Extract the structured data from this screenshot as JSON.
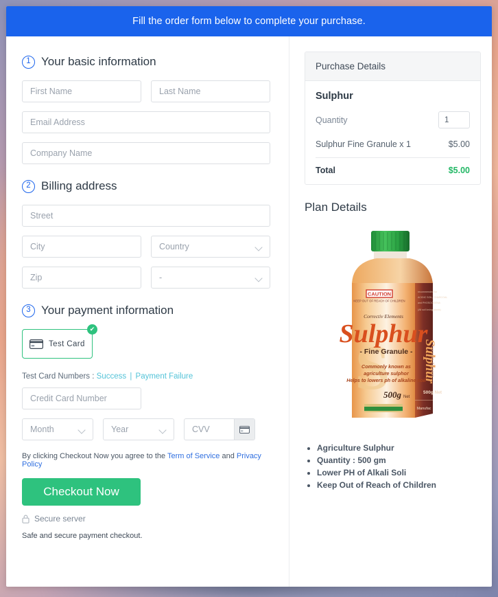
{
  "banner": {
    "text": "Fill the order form below to complete your purchase."
  },
  "sections": {
    "basic": {
      "number": "1",
      "title": "Your basic information",
      "fields": {
        "first_name": "First Name",
        "last_name": "Last Name",
        "email": "Email Address",
        "company": "Company Name"
      }
    },
    "billing": {
      "number": "2",
      "title": "Billing address",
      "fields": {
        "street": "Street",
        "city": "City",
        "country": "Country",
        "zip": "Zip",
        "state": "-"
      }
    },
    "payment": {
      "number": "3",
      "title": "Your payment information",
      "method": {
        "label": "Test Card",
        "icon": "credit-card-icon",
        "selected_icon": "check-circle-icon",
        "selected_check": "✔"
      },
      "test_cards": {
        "prefix": "Test Card Numbers :",
        "success": "Success",
        "separator": "|",
        "failure": "Payment Failure"
      },
      "fields": {
        "card_number": "Credit Card Number",
        "month": "Month",
        "year": "Year",
        "cvv": "CVV"
      }
    }
  },
  "terms": {
    "prefix": "By clicking Checkout Now you agree to the",
    "link1": "Term of Service",
    "middle": "and",
    "link2": "Privacy Policy"
  },
  "checkout": {
    "button_label": "Checkout Now",
    "secure_label": "Secure server",
    "lock_icon": "lock-icon",
    "safe_note": "Safe and secure payment checkout."
  },
  "purchase": {
    "header": "Purchase Details",
    "product_name": "Sulphur",
    "quantity_label": "Quantity",
    "quantity_value": "1",
    "line_item_label": "Sulphur Fine Granule x 1",
    "line_item_price": "$5.00",
    "total_label": "Total",
    "total_price": "$5.00"
  },
  "plan": {
    "title": "Plan Details",
    "image": {
      "alt": "sulphur-fine-granule-package",
      "cap_color": "#27a844",
      "body_color": "#f0a35a",
      "side_color": "#8c3a2f",
      "caution_label": "CAUTION",
      "caution_sub": "KEEP OUT OF REACH OF CHILDREN",
      "brand_line": "Correctiv Elements",
      "product_title": "Sulphur",
      "product_sub": "- Fine Granule -",
      "desc_line1": "Commonly known as",
      "desc_line2": "agriculture sulphor",
      "desc_line3": "Helps to lowers ph of alkaline soil",
      "weight": "500g",
      "weight_unit": "Net",
      "watermark": "S",
      "side_text": "Sulphur",
      "side_sub": "Correctiv Elements",
      "side_weight": "500g Net",
      "side_footer": "Manufac"
    },
    "features": [
      "Agriculture Sulphur",
      "Quantity : 500 gm",
      "Lower PH of Alkali Soli",
      "Keep Out of Reach of Children"
    ]
  },
  "colors": {
    "banner_blue": "#1a63ec",
    "accent_green": "#2ec27e",
    "total_green": "#24b866",
    "link_cyan": "#53c3d8",
    "link_blue": "#2f6fe0"
  }
}
